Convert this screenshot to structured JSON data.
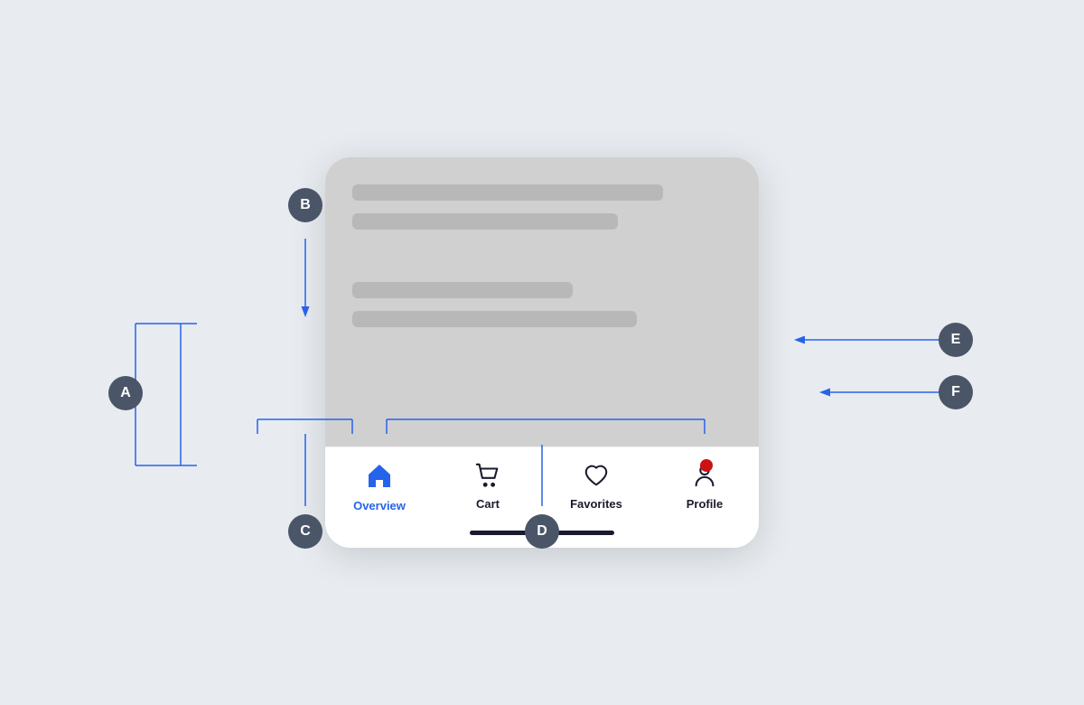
{
  "page": {
    "background_color": "#e8ecf0"
  },
  "content_bars": [
    {
      "width": "82%"
    },
    {
      "width": "70%"
    },
    {
      "width": "58%"
    },
    {
      "width": "75%"
    }
  ],
  "tab_bar": {
    "tabs": [
      {
        "id": "overview",
        "label": "Overview",
        "active": true
      },
      {
        "id": "cart",
        "label": "Cart",
        "active": false
      },
      {
        "id": "favorites",
        "label": "Favorites",
        "active": false
      },
      {
        "id": "profile",
        "label": "Profile",
        "active": false
      }
    ]
  },
  "annotations": {
    "A": {
      "label": "A"
    },
    "B": {
      "label": "B"
    },
    "C": {
      "label": "C"
    },
    "D": {
      "label": "D"
    },
    "E": {
      "label": "E"
    },
    "F": {
      "label": "F"
    }
  }
}
